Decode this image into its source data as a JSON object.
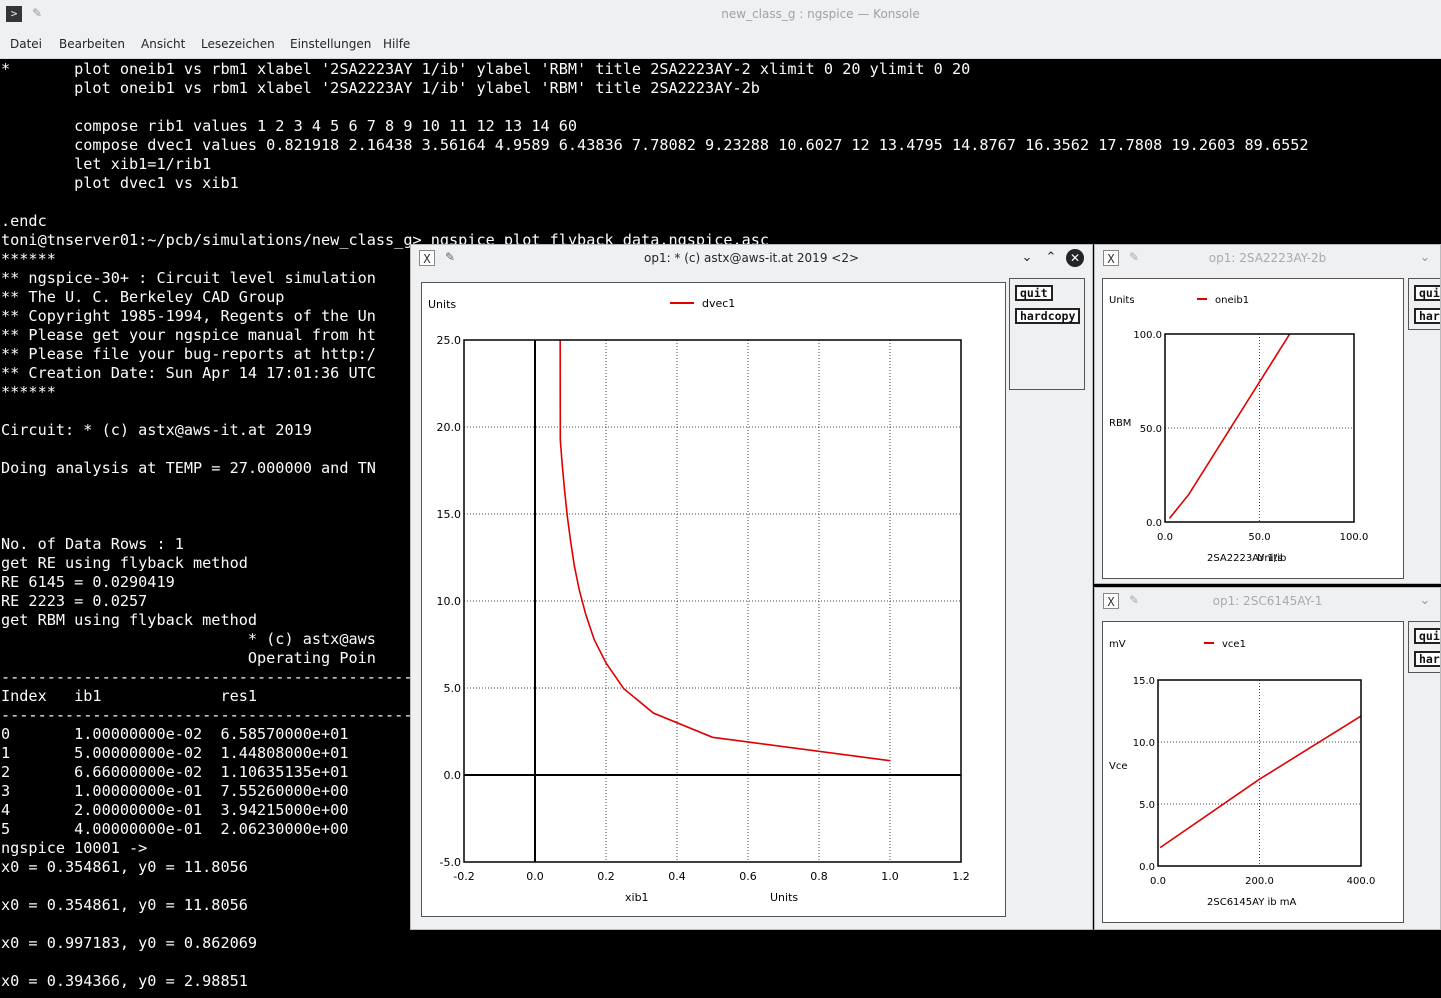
{
  "konsole": {
    "title": "new_class_g : ngspice — Konsole",
    "menu": [
      "Datei",
      "Bearbeiten",
      "Ansicht",
      "Lesezeichen",
      "Einstellungen",
      "Hilfe"
    ]
  },
  "terminal": {
    "lines": [
      "*       plot oneib1 vs rbm1 xlabel '2SA2223AY 1/ib' ylabel 'RBM' title 2SA2223AY-2 xlimit 0 20 ylimit 0 20",
      "        plot oneib1 vs rbm1 xlabel '2SA2223AY 1/ib' ylabel 'RBM' title 2SA2223AY-2b",
      "",
      "        compose rib1 values 1 2 3 4 5 6 7 8 9 10 11 12 13 14 60",
      "        compose dvec1 values 0.821918 2.16438 3.56164 4.9589 6.43836 7.78082 9.23288 10.6027 12 13.4795 14.8767 16.3562 17.7808 19.2603 89.6552",
      "        let xib1=1/rib1",
      "        plot dvec1 vs xib1",
      "",
      ".endc",
      "toni@tnserver01:~/pcb/simulations/new_class_g> ngspice plot_flyback_data.ngspice.asc",
      "******",
      "** ngspice-30+ : Circuit level simulation",
      "** The U. C. Berkeley CAD Group",
      "** Copyright 1985-1994, Regents of the Un",
      "** Please get your ngspice manual from ht",
      "** Please file your bug-reports at http:/",
      "** Creation Date: Sun Apr 14 17:01:36 UTC",
      "******",
      "",
      "Circuit: * (c) astx@aws-it.at 2019",
      "",
      "Doing analysis at TEMP = 27.000000 and TN",
      "",
      "",
      "",
      "No. of Data Rows : 1",
      "get RE using flyback method",
      "RE 6145 = 0.0290419",
      "RE 2223 = 0.0257",
      "get RBM using flyback method",
      "                           * (c) astx@aws",
      "                           Operating Poin",
      "---------------------------------------------------",
      "Index   ib1             res1",
      "---------------------------------------------------",
      "0       1.00000000e-02  6.58570000e+01",
      "1       5.00000000e-02  1.44808000e+01",
      "2       6.66000000e-02  1.10635135e+01",
      "3       1.00000000e-01  7.55260000e+00",
      "4       2.00000000e-01  3.94215000e+00",
      "5       4.00000000e-01  2.06230000e+00",
      "ngspice 10001 ->",
      "x0 = 0.354861, y0 = 11.8056",
      "",
      "x0 = 0.354861, y0 = 11.8056",
      "",
      "x0 = 0.997183, y0 = 0.862069",
      "",
      "x0 = 0.394366, y0 = 2.98851"
    ]
  },
  "buttons": {
    "quit": "quit",
    "hardcopy": "hardcopy"
  },
  "windows": {
    "main": {
      "title": "op1: * (c) astx@aws-it.at 2019 <2>"
    },
    "top": {
      "title": "op1: 2SA2223AY-2b"
    },
    "bottom": {
      "title": "op1: 2SC6145AY-1"
    }
  },
  "colors": {
    "trace": "#e00000",
    "terminal_bg": "#000000",
    "terminal_fg": "#fcfcfc"
  },
  "chart_data": [
    {
      "type": "line",
      "title": "",
      "units_label": "Units",
      "xlabel": "xib1",
      "xunits": "Units",
      "ylabel": "",
      "legend": "top-center",
      "grid": true,
      "xlim": [
        -0.2,
        1.2
      ],
      "ylim": [
        -5.0,
        25.0
      ],
      "xticks": [
        "-0.2",
        "0.0",
        "0.2",
        "0.4",
        "0.6",
        "0.8",
        "1.0",
        "1.2"
      ],
      "yticks": [
        "-5.0",
        "0.0",
        "5.0",
        "10.0",
        "15.0",
        "20.0",
        "25.0"
      ],
      "series": [
        {
          "name": "dvec1",
          "x": [
            1.0,
            0.5,
            0.3333,
            0.25,
            0.2,
            0.1667,
            0.1429,
            0.125,
            0.1111,
            0.1,
            0.0909,
            0.0833,
            0.0769,
            0.0714,
            0.0667
          ],
          "y": [
            0.821918,
            2.16438,
            3.56164,
            4.9589,
            6.43836,
            7.78082,
            9.23288,
            10.6027,
            12,
            13.4795,
            14.8767,
            16.3562,
            17.7808,
            19.2603,
            89.6552
          ]
        }
      ]
    },
    {
      "type": "line",
      "title": "",
      "units_label": "Units",
      "xlabel": "2SA2223AY 1/ib",
      "xunits": "Units",
      "ylabel": "RBM",
      "legend": "top-center",
      "grid": true,
      "xlim": [
        0.0,
        100.0
      ],
      "ylim": [
        0.0,
        100.0
      ],
      "xticks": [
        "0.0",
        "50.0",
        "100.0"
      ],
      "yticks": [
        "0.0",
        "50.0",
        "100.0"
      ],
      "series": [
        {
          "name": "oneib1",
          "x": [
            2.5,
            12.5,
            66,
            100
          ],
          "y": [
            2.1,
            14.5,
            100,
            150
          ]
        }
      ]
    },
    {
      "type": "line",
      "title": "",
      "units_label": "mV",
      "xlabel": "2SC6145AY ib mA",
      "xunits": "",
      "ylabel": "Vce",
      "legend": "top-center",
      "grid": true,
      "xlim": [
        0.0,
        400.0
      ],
      "ylim": [
        0.0,
        15.0
      ],
      "xticks": [
        "0.0",
        "200.0",
        "400.0"
      ],
      "yticks": [
        "0.0",
        "5.0",
        "10.0",
        "15.0"
      ],
      "series": [
        {
          "name": "vce1",
          "x": [
            5,
            200,
            400
          ],
          "y": [
            1.5,
            7.0,
            12.1
          ]
        }
      ]
    }
  ]
}
